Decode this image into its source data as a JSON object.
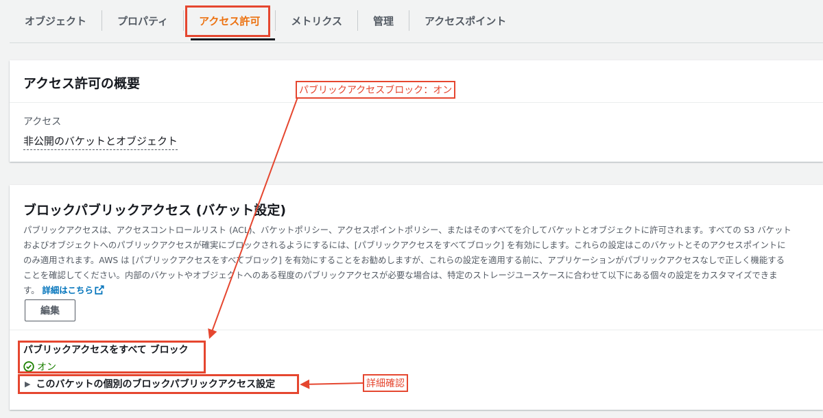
{
  "tabs": [
    {
      "label": "オブジェクト"
    },
    {
      "label": "プロパティ"
    },
    {
      "label": "アクセス許可",
      "active": true
    },
    {
      "label": "メトリクス"
    },
    {
      "label": "管理"
    },
    {
      "label": "アクセスポイント"
    }
  ],
  "overview": {
    "title": "アクセス許可の概要",
    "access_label": "アクセス",
    "access_value": "非公開のバケットとオブジェクト"
  },
  "block_public_access": {
    "title": "ブロックパブリックアクセス (バケット設定)",
    "description": "パブリックアクセスは、アクセスコントロールリスト (ACL)、バケットポリシー、アクセスポイントポリシー、またはそのすべてを介してバケットとオブジェクトに許可されます。すべての S3 バケットおよびオブジェクトへのパブリックアクセスが確実にブロックされるようにするには、[パブリックアクセスをすべてブロック] を有効にします。これらの設定はこのバケットとそのアクセスポイントにのみ適用されます。AWS は [パブリックアクセスをすべてブロック] を有効にすることをお勧めしますが、これらの設定を適用する前に、アプリケーションがパブリックアクセスなしで正しく機能することを確認してください。内部のバケットやオブジェクトへのある程度のパブリックアクセスが必要な場合は、特定のストレージユースケースに合わせて以下にある個々の設定をカスタマイズできます。",
    "learn_more": "詳細はこちら",
    "edit_button": "編集",
    "block_all_title": "パブリックアクセスをすべて ブロック",
    "block_all_status": "オン",
    "expander_label": "このバケットの個別のブロックパブリックアクセス設定"
  },
  "annotations": {
    "callout_1": "パブリックアクセスブロック：オン",
    "callout_2": "詳細確認",
    "color": "#e5462f"
  },
  "colors": {
    "accent": "#ec7211",
    "link": "#0073bb",
    "success": "#1d8102"
  }
}
